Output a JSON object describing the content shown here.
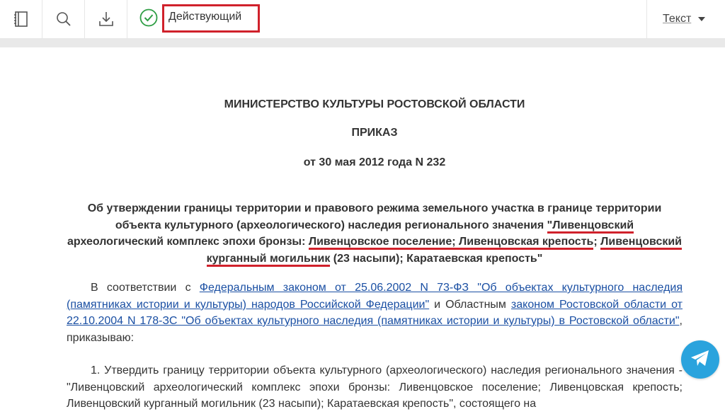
{
  "toolbar": {
    "icons": [
      "bookmark-book-icon",
      "search-icon",
      "download-icon"
    ],
    "status_label": "Действующий",
    "view_label": "Текст"
  },
  "document": {
    "ministry": "МИНИСТЕРСТВО КУЛЬТУРЫ РОСТОВСКОЙ ОБЛАСТИ",
    "type": "ПРИКАЗ",
    "date_number": "от 30 мая 2012 года N 232",
    "subject": {
      "p1": "Об утверждении границы территории и правового режима земельного участка в границе территории объекта культурного (археологического) наследия регионального значения ",
      "u1": "\"Ливенцовский",
      "p2": " археологический комплекс эпохи бронзы: ",
      "u2": "Ливенцовское поселение; Ливенцовская крепость",
      "p3": "; ",
      "u3": "Ливенцовский курганный могильник",
      "p4": " (23 насыпи); Каратаевская крепость\""
    },
    "para1": {
      "t1": "В соответствии с ",
      "link1": "Федеральным законом от 25.06.2002 N 73-ФЗ \"Об объектах культурного наследия (памятниках истории и культуры) народов Российской Федерации\"",
      "t2": " и Областным ",
      "link2": "законом Ростовской области от 22.10.2004 N 178-ЗС \"Об объектах культурного наследия (памятниках истории и культуры) в Ростовской области\"",
      "t3": ", приказываю:"
    },
    "para2": "1. Утвердить границу территории объекта культурного (археологического) наследия регионального значения - \"Ливенцовский археологический комплекс эпохи бронзы: Ливенцовское поселение; Ливенцовская крепость; Ливенцовский курганный могильник (23 насыпи); Каратаевская крепость\", состоящего на"
  },
  "colors": {
    "highlight_red": "#d0212b",
    "status_green": "#2e9e44",
    "link_blue": "#1a4fa3",
    "telegram_blue": "#2aa3dd"
  }
}
